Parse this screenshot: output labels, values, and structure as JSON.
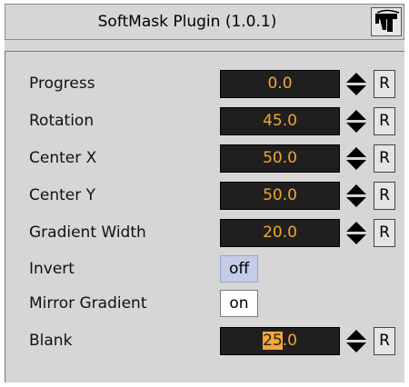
{
  "header": {
    "title": "SoftMask Plugin (1.0.1)",
    "icon": "plugin-logo-icon"
  },
  "params": [
    {
      "label": "Progress",
      "value": "0.0"
    },
    {
      "label": "Rotation",
      "value": "45.0"
    },
    {
      "label": "Center X",
      "value": "50.0"
    },
    {
      "label": "Center Y",
      "value": "50.0"
    },
    {
      "label": "Gradient Width",
      "value": "20.0"
    }
  ],
  "toggles": [
    {
      "label": "Invert",
      "value": "off"
    },
    {
      "label": "Mirror Gradient",
      "value": "on"
    }
  ],
  "blank": {
    "label": "Blank",
    "value_selected": "25",
    "value_rest": ".0"
  },
  "reset_label": "R",
  "colors": {
    "panel_bg": "#d6d6d6",
    "field_bg": "#1f1f1f",
    "field_text": "#f0a832",
    "toggle_off_bg": "#c3cde6"
  }
}
